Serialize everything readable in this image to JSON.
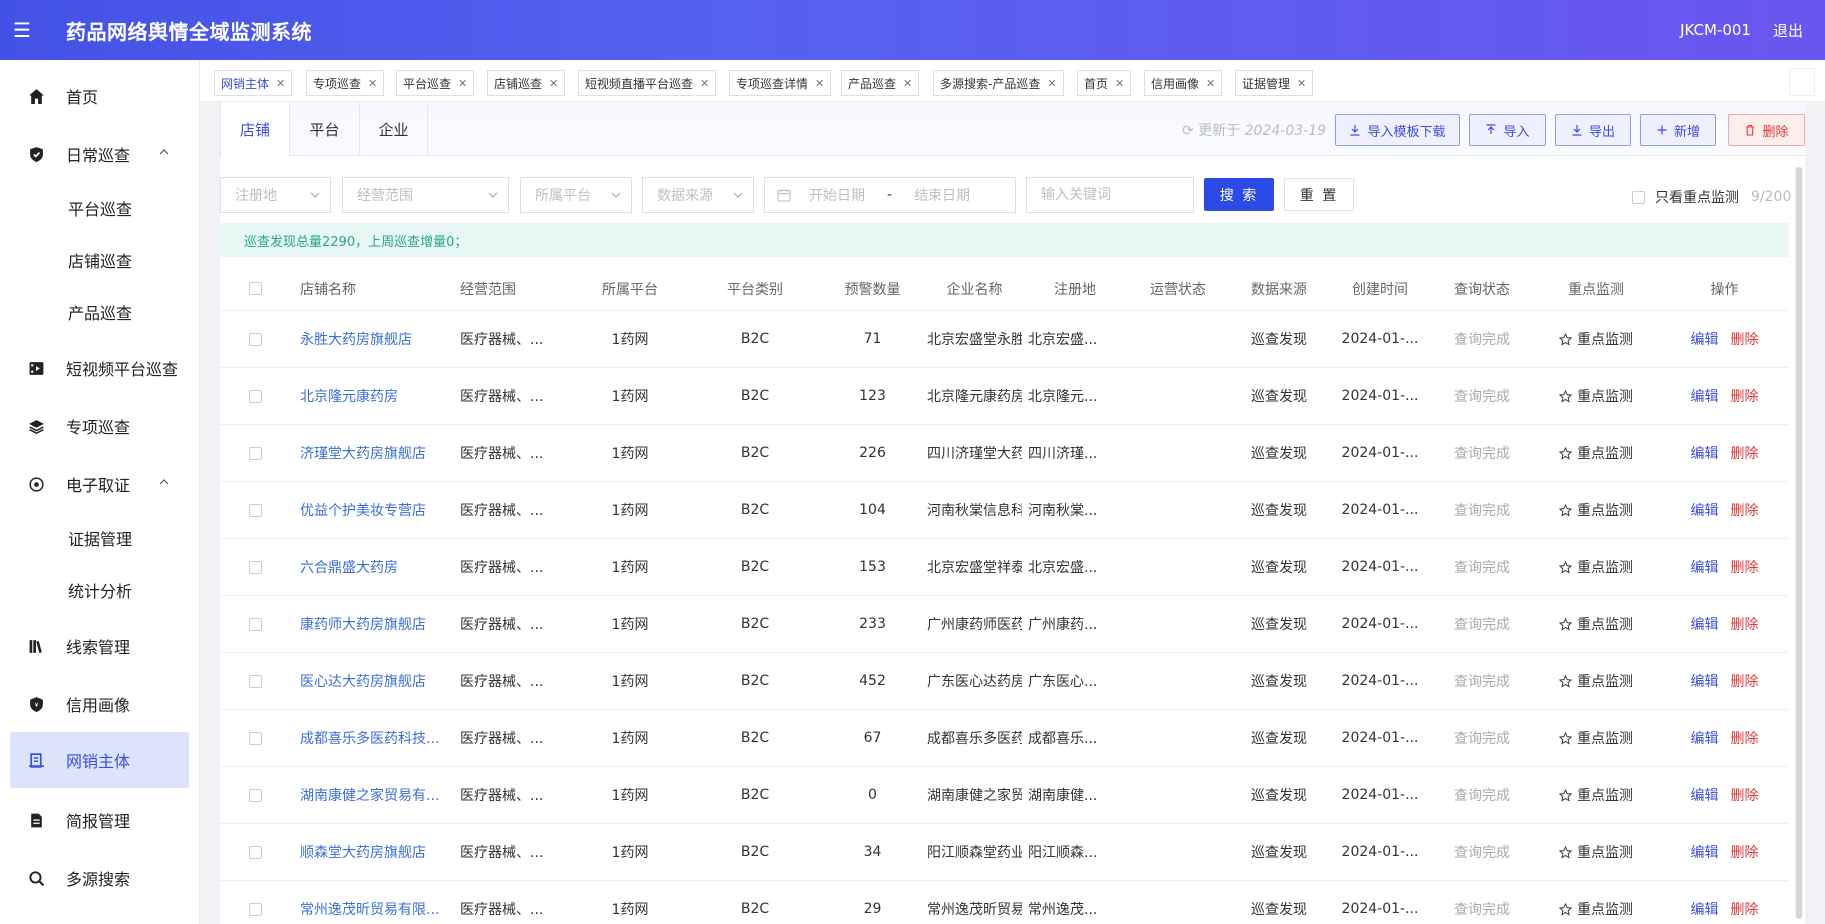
{
  "header": {
    "title": "药品网络舆情全域监测系统",
    "user": "JKCM-001",
    "logout": "退出"
  },
  "sidebar": {
    "items": [
      {
        "label": "首页",
        "icon": "home-icon"
      },
      {
        "label": "日常巡查",
        "icon": "shield-icon"
      },
      {
        "label": "平台巡查"
      },
      {
        "label": "店铺巡查"
      },
      {
        "label": "产品巡查"
      },
      {
        "label": "短视频平台巡查",
        "icon": "video-icon"
      },
      {
        "label": "专项巡查",
        "icon": "layers-icon"
      },
      {
        "label": "电子取证",
        "icon": "evidence-icon"
      },
      {
        "label": "证据管理"
      },
      {
        "label": "统计分析"
      },
      {
        "label": "线索管理",
        "icon": "books-icon"
      },
      {
        "label": "信用画像",
        "icon": "badge-icon"
      },
      {
        "label": "网销主体",
        "icon": "entity-icon"
      },
      {
        "label": "简报管理",
        "icon": "report-icon"
      },
      {
        "label": "多源搜索",
        "icon": "search-icon"
      }
    ]
  },
  "tags": [
    "网销主体",
    "专项巡查",
    "平台巡查",
    "店铺巡查",
    "短视频直播平台巡查",
    "专项巡查详情",
    "产品巡查",
    "多源搜索-产品巡查",
    "首页",
    "信用画像",
    "证据管理"
  ],
  "tabs": [
    "店铺",
    "平台",
    "企业"
  ],
  "toolbar": {
    "updated_prefix": "更新于",
    "updated_date": "2024-03-19",
    "template": "导入模板下载",
    "import": "导入",
    "export": "导出",
    "add": "新增",
    "delete": "删除"
  },
  "filters": {
    "region": "注册地",
    "scope": "经营范围",
    "platform": "所属平台",
    "source": "数据来源",
    "start": "开始日期",
    "sep": "-",
    "end": "结束日期",
    "keyword": "输入关键词",
    "search": "搜 索",
    "reset": "重 置",
    "only_focus": "只看重点监测",
    "count": "9/200"
  },
  "alert": "巡查发现总量2290，上周巡查增量0；",
  "table": {
    "columns": [
      "店铺名称",
      "经营范围",
      "所属平台",
      "平台类别",
      "预警数量",
      "企业名称",
      "注册地",
      "运营状态",
      "数据来源",
      "创建时间",
      "查询状态",
      "重点监测",
      "操作"
    ],
    "rows": [
      [
        "永胜大药房旗舰店",
        "医疗器械、...",
        "1药网",
        "B2C",
        "71",
        "北京宏盛堂永胜",
        "北京宏盛...",
        "",
        "巡查发现",
        "2024-01-...",
        "查询完成",
        "重点监测"
      ],
      [
        "北京隆元康药房",
        "医疗器械、...",
        "1药网",
        "B2C",
        "123",
        "北京隆元康药房",
        "北京隆元...",
        "",
        "巡查发现",
        "2024-01-...",
        "查询完成",
        "重点监测"
      ],
      [
        "济瑾堂大药房旗舰店",
        "医疗器械、...",
        "1药网",
        "B2C",
        "226",
        "四川济瑾堂大药",
        "四川济瑾...",
        "",
        "巡查发现",
        "2024-01-...",
        "查询完成",
        "重点监测"
      ],
      [
        "优益个护美妆专营店",
        "医疗器械、...",
        "1药网",
        "B2C",
        "104",
        "河南秋棠信息科",
        "河南秋棠...",
        "",
        "巡查发现",
        "2024-01-...",
        "查询完成",
        "重点监测"
      ],
      [
        "六合鼎盛大药房",
        "医疗器械、...",
        "1药网",
        "B2C",
        "153",
        "北京宏盛堂祥泰",
        "北京宏盛...",
        "",
        "巡查发现",
        "2024-01-...",
        "查询完成",
        "重点监测"
      ],
      [
        "康药师大药房旗舰店",
        "医疗器械、...",
        "1药网",
        "B2C",
        "233",
        "广州康药师医药",
        "广州康药...",
        "",
        "巡查发现",
        "2024-01-...",
        "查询完成",
        "重点监测"
      ],
      [
        "医心达大药房旗舰店",
        "医疗器械、...",
        "1药网",
        "B2C",
        "452",
        "广东医心达药房",
        "广东医心...",
        "",
        "巡查发现",
        "2024-01-...",
        "查询完成",
        "重点监测"
      ],
      [
        "成都喜乐多医药科技...",
        "医疗器械、...",
        "1药网",
        "B2C",
        "67",
        "成都喜乐多医药",
        "成都喜乐...",
        "",
        "巡查发现",
        "2024-01-...",
        "查询完成",
        "重点监测"
      ],
      [
        "湖南康健之家贸易有...",
        "医疗器械、...",
        "1药网",
        "B2C",
        "0",
        "湖南康健之家贸",
        "湖南康健...",
        "",
        "巡查发现",
        "2024-01-...",
        "查询完成",
        "重点监测"
      ],
      [
        "顺森堂大药房旗舰店",
        "医疗器械、...",
        "1药网",
        "B2C",
        "34",
        "阳江顺森堂药业",
        "阳江顺森...",
        "",
        "巡查发现",
        "2024-01-...",
        "查询完成",
        "重点监测"
      ],
      [
        "常州逸茂昕贸易有限...",
        "医疗器械、...",
        "1药网",
        "B2C",
        "29",
        "常州逸茂昕贸易",
        "常州逸茂...",
        "",
        "巡查发现",
        "2024-01-...",
        "查询完成",
        "重点监测"
      ]
    ],
    "actions": {
      "edit": "编辑",
      "delete": "删除"
    }
  },
  "colors": {
    "accent": "#3b4ee0",
    "danger": "#e03a3a",
    "success": "#2aa68c",
    "header_from": "#4352e6",
    "header_to": "#6a56ef"
  }
}
